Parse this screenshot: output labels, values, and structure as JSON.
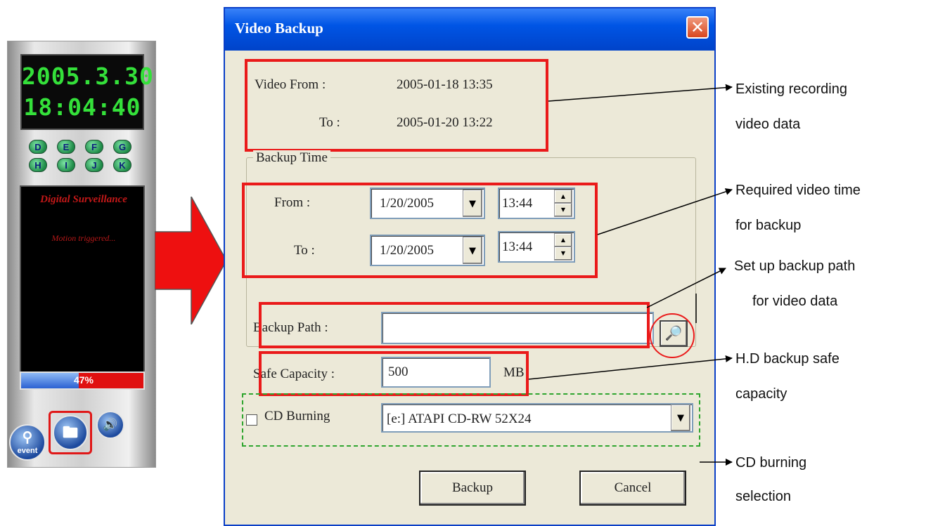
{
  "dvr": {
    "date": "2005.3.30",
    "time": "18:04:40",
    "drive_buttons": [
      "D",
      "E",
      "F",
      "G",
      "H",
      "I",
      "J",
      "K"
    ],
    "brand": "Digital Surveillance",
    "status": "Motion triggered...",
    "progress_label": "47%",
    "progress_fraction": 0.47,
    "event_label": "event"
  },
  "dialog": {
    "title": "Video Backup",
    "video_from_label": "Video From :",
    "video_from_value": "2005-01-18 13:35",
    "video_to_label": "To :",
    "video_to_value": "2005-01-20 13:22",
    "backup_time_group": "Backup Time",
    "from_label": "From :",
    "from_date": "1/20/2005",
    "from_time": "13:44",
    "to_label": "To :",
    "to_date": "1/20/2005",
    "to_time": "13:44",
    "backup_path_label": "Backup Path :",
    "backup_path_value": "",
    "safe_capacity_label": "Safe Capacity :",
    "safe_capacity_value": "500",
    "safe_capacity_unit": "MB",
    "cd_burning_label": "CD Burning",
    "cd_burning_checked": false,
    "cd_drive": "[e:] ATAPI   CD-RW 52X24",
    "backup_button": "Backup",
    "cancel_button": "Cancel"
  },
  "annotations": {
    "existing_line1": "Existing recording",
    "existing_line2": "video data",
    "required_line1": "Required video time",
    "required_line2": "for backup",
    "path_line1": "Set  up  backup  path",
    "path_line2": "for video data",
    "capacity_line1": "H.D backup safe",
    "capacity_line2": "capacity",
    "cd_line1": "CD burning",
    "cd_line2": "selection"
  },
  "colors": {
    "highlight": "#ea1a1a",
    "dashed_green": "#2fa52f",
    "titlebar": "#0055e5",
    "lcd_green": "#34e03a"
  }
}
